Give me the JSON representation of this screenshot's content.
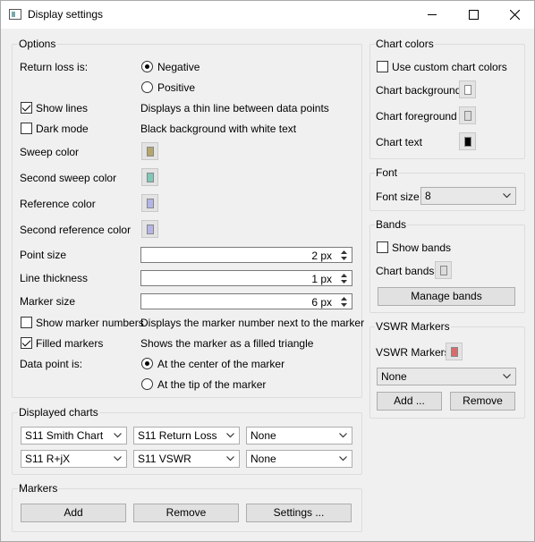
{
  "window": {
    "title": "Display settings"
  },
  "options": {
    "title": "Options",
    "return_loss_label": "Return loss is:",
    "negative_label": "Negative",
    "positive_label": "Positive",
    "show_lines_label": "Show lines",
    "show_lines_desc": "Displays a thin line between data points",
    "dark_mode_label": "Dark mode",
    "dark_mode_desc": "Black background with white text",
    "sweep_color_label": "Sweep color",
    "second_sweep_color_label": "Second sweep color",
    "reference_color_label": "Reference color",
    "second_reference_color_label": "Second reference color",
    "point_size_label": "Point size",
    "point_size_value": "2 px",
    "line_thickness_label": "Line thickness",
    "line_thickness_value": "1 px",
    "marker_size_label": "Marker size",
    "marker_size_value": "6 px",
    "show_marker_numbers_label": "Show marker numbers",
    "show_marker_numbers_desc": "Displays the marker number next to the marker",
    "filled_markers_label": "Filled markers",
    "filled_markers_desc": "Shows the marker as a filled triangle",
    "data_point_label": "Data point is:",
    "center_label": "At the center of the marker",
    "tip_label": "At the tip of the marker"
  },
  "displayed_charts": {
    "title": "Displayed charts",
    "row1": [
      "S11 Smith Chart",
      "S11 Return Loss",
      "None"
    ],
    "row2": [
      "S11 R+jX",
      "S11 VSWR",
      "None"
    ]
  },
  "markers": {
    "title": "Markers",
    "add_label": "Add",
    "remove_label": "Remove",
    "settings_label": "Settings ..."
  },
  "chart_colors": {
    "title": "Chart colors",
    "use_custom_label": "Use custom chart colors",
    "background_label": "Chart background",
    "foreground_label": "Chart foreground",
    "text_label": "Chart text"
  },
  "font": {
    "title": "Font",
    "size_label": "Font size",
    "size_value": "8"
  },
  "bands": {
    "title": "Bands",
    "show_label": "Show bands",
    "chart_bands_label": "Chart bands",
    "manage_label": "Manage bands"
  },
  "vswr": {
    "title": "VSWR Markers",
    "label": "VSWR Markers",
    "selected": "None",
    "add_label": "Add ...",
    "remove_label": "Remove"
  },
  "colors": {
    "sweep": "#b5a66c",
    "second_sweep": "#7fc8b8",
    "reference": "#b4b4e8",
    "second_reference": "#b4b4e8",
    "chart_background": "#ffffff",
    "chart_foreground": "#dcdcdc",
    "chart_text": "#000000",
    "chart_bands": "#dcdcdc",
    "vswr_marker": "#d96b6b"
  },
  "icons": [
    "app-icon",
    "minimize-icon",
    "maximize-icon",
    "close-icon",
    "chevron-down-icon",
    "spin-up-icon",
    "spin-down-icon"
  ]
}
